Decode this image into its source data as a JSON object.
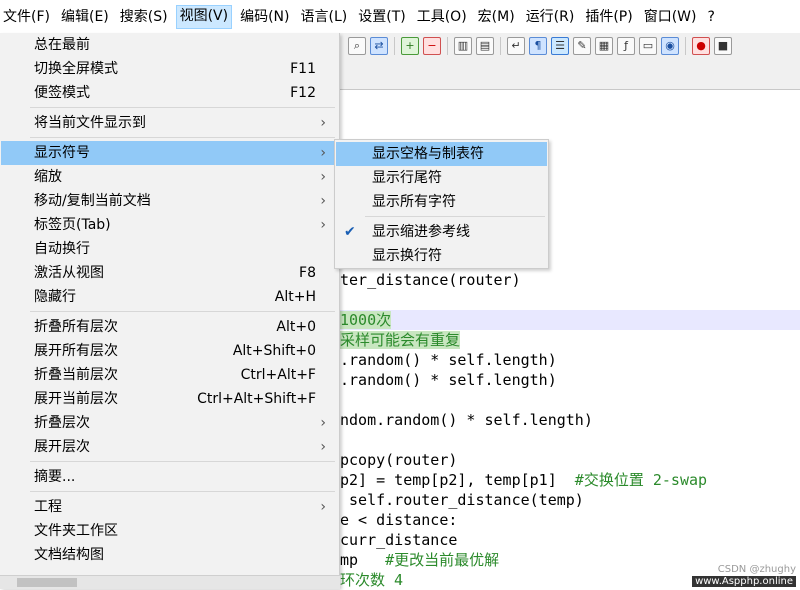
{
  "menubar": {
    "items": [
      "文件(F)",
      "编辑(E)",
      "搜索(S)",
      "视图(V)",
      "编码(N)",
      "语言(L)",
      "设置(T)",
      "工具(O)",
      "宏(M)",
      "运行(R)",
      "插件(P)",
      "窗口(W)",
      "?"
    ],
    "active": "视图(V)"
  },
  "toolbar": {
    "icons": [
      "binoculars-icon",
      "replace-icon",
      "zoom-in-icon",
      "zoom-out-icon",
      "sync-vertical-icon",
      "sync-horizontal-icon",
      "word-wrap-icon",
      "pilcrow-icon",
      "indent-guide-icon",
      "user-language-icon",
      "document-map-icon",
      "function-list-icon",
      "folder-workspace-icon",
      "monitor-icon",
      "record-macro-icon",
      "stop-record-icon"
    ]
  },
  "view_menu": {
    "items": [
      {
        "label": "总在最前",
        "shortcut": "",
        "submenu": false
      },
      {
        "label": "切换全屏模式",
        "shortcut": "F11",
        "submenu": false
      },
      {
        "label": "便签模式",
        "shortcut": "F12",
        "submenu": false
      },
      {
        "label": "将当前文件显示到",
        "shortcut": "",
        "submenu": true
      },
      {
        "label": "显示符号",
        "shortcut": "",
        "submenu": true
      },
      {
        "label": "缩放",
        "shortcut": "",
        "submenu": true
      },
      {
        "label": "移动/复制当前文档",
        "shortcut": "",
        "submenu": true
      },
      {
        "label": "标签页(Tab)",
        "shortcut": "",
        "submenu": true
      },
      {
        "label": "自动换行",
        "shortcut": "",
        "submenu": false
      },
      {
        "label": "激活从视图",
        "shortcut": "F8",
        "submenu": false
      },
      {
        "label": "隐藏行",
        "shortcut": "Alt+H",
        "submenu": false
      },
      {
        "label": "折叠所有层次",
        "shortcut": "Alt+0",
        "submenu": false
      },
      {
        "label": "展开所有层次",
        "shortcut": "Alt+Shift+0",
        "submenu": false
      },
      {
        "label": "折叠当前层次",
        "shortcut": "Ctrl+Alt+F",
        "submenu": false
      },
      {
        "label": "展开当前层次",
        "shortcut": "Ctrl+Alt+Shift+F",
        "submenu": false
      },
      {
        "label": "折叠层次",
        "shortcut": "",
        "submenu": true
      },
      {
        "label": "展开层次",
        "shortcut": "",
        "submenu": true
      },
      {
        "label": "摘要...",
        "shortcut": "",
        "submenu": false
      },
      {
        "label": "工程",
        "shortcut": "",
        "submenu": true
      },
      {
        "label": "文件夹工作区",
        "shortcut": "",
        "submenu": false
      },
      {
        "label": "文档结构图",
        "shortcut": "",
        "submenu": false
      }
    ],
    "hovered": "显示符号"
  },
  "symbols_submenu": {
    "items": [
      {
        "label": "显示空格与制表符",
        "checked": false
      },
      {
        "label": "显示行尾符",
        "checked": false
      },
      {
        "label": "显示所有字符",
        "checked": false
      },
      {
        "label": "显示缩进参考线",
        "checked": true
      },
      {
        "label": "显示换行符",
        "checked": false
      }
    ],
    "hovered": "显示空格与制表符"
  },
  "editor": {
    "lines": [
      {
        "text": "ter_distance(router)",
        "kind": "code"
      },
      {
        "text": "1000次",
        "kind": "comment"
      },
      {
        "text": "采样可能会有重复",
        "kind": "comment"
      },
      {
        "text": ".random() * self.length)",
        "kind": "code"
      },
      {
        "text": ".random() * self.length)",
        "kind": "code"
      },
      {
        "text": "ndom.random() * self.length)",
        "kind": "code"
      },
      {
        "text": "pcopy(router)",
        "kind": "code"
      },
      {
        "text": "p2] = temp[p2], temp[p1]",
        "kind": "code",
        "comment": "  #交换位置 2-swap"
      },
      {
        "text": " self.router_distance(temp)",
        "kind": "code"
      },
      {
        "text": "e < distance:",
        "kind": "code"
      },
      {
        "text": "curr_distance",
        "kind": "code"
      },
      {
        "text": "mp",
        "kind": "code",
        "comment": "   #更改当前最优解"
      },
      {
        "text": "",
        "kind": "comment",
        "comment": "环次数 4"
      }
    ]
  },
  "watermark": {
    "csdn": "CSDN @zhughy",
    "site": "www.Aspphp.online"
  },
  "colors": {
    "menu_bg": "#f2f2f2",
    "hover": "#91c9f7",
    "menubar_active": "#cce8ff",
    "comment": "#2b8a2b",
    "keyword": "#00009a"
  }
}
